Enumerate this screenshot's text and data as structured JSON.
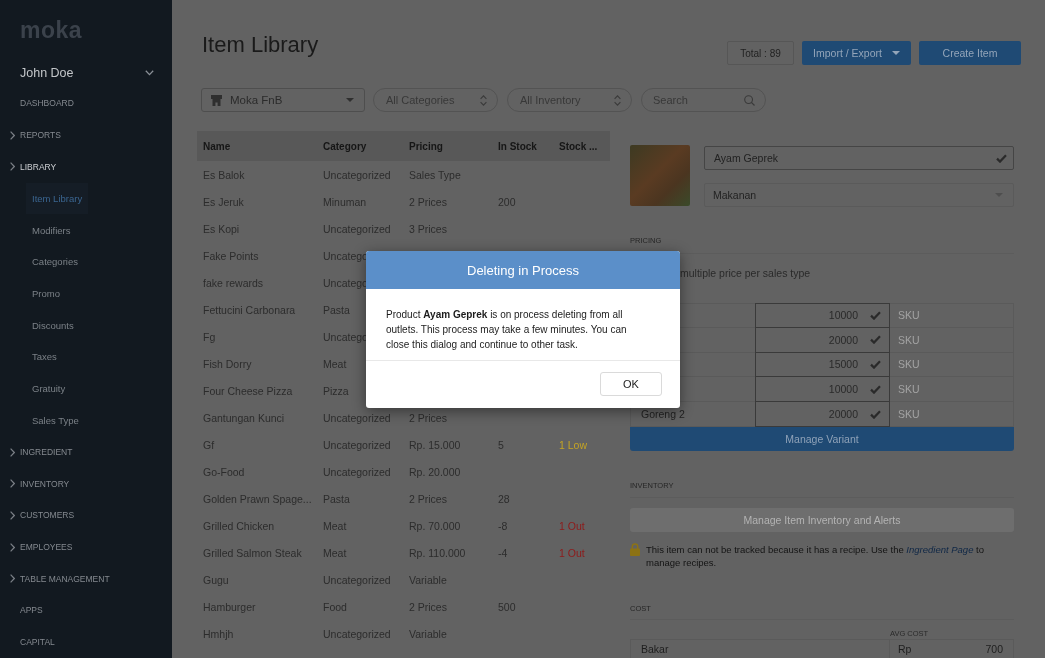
{
  "sidebar": {
    "logo": "moka",
    "user": "John Doe",
    "items": [
      {
        "label": "DASHBOARD",
        "kind": "link",
        "selected": false
      },
      {
        "label": "REPORTS",
        "kind": "group",
        "expanded": false,
        "selected": false
      },
      {
        "label": "LIBRARY",
        "kind": "group",
        "expanded": true,
        "selected": false,
        "children": [
          {
            "label": "Item Library",
            "selected": true
          },
          {
            "label": "Modifiers",
            "selected": false
          },
          {
            "label": "Categories",
            "selected": false
          },
          {
            "label": "Promo",
            "selected": false
          },
          {
            "label": "Discounts",
            "selected": false
          },
          {
            "label": "Taxes",
            "selected": false
          },
          {
            "label": "Gratuity",
            "selected": false
          },
          {
            "label": "Sales Type",
            "selected": false
          }
        ]
      },
      {
        "label": "INGREDIENT",
        "kind": "group",
        "expanded": false,
        "selected": false
      },
      {
        "label": "INVENTORY",
        "kind": "group",
        "expanded": false,
        "selected": false
      },
      {
        "label": "CUSTOMERS",
        "kind": "group",
        "expanded": false,
        "selected": false
      },
      {
        "label": "EMPLOYEES",
        "kind": "group",
        "expanded": false,
        "selected": false
      },
      {
        "label": "TABLE MANAGEMENT",
        "kind": "group",
        "expanded": false,
        "selected": false
      },
      {
        "label": "APPS",
        "kind": "link",
        "selected": false
      },
      {
        "label": "CAPITAL",
        "kind": "link",
        "selected": false
      }
    ]
  },
  "header": {
    "title": "Item Library",
    "total": "Total : 89",
    "buttons": [
      {
        "label": "Import / Export",
        "kind": "dropdown"
      },
      {
        "label": "Create Item",
        "kind": "primary"
      }
    ]
  },
  "filters": [
    {
      "kind": "outlet",
      "value": "Moka FnB"
    },
    {
      "kind": "select",
      "value": "All Categories"
    },
    {
      "kind": "select",
      "value": "All Inventory"
    },
    {
      "kind": "search",
      "placeholder": "Search"
    }
  ],
  "table": {
    "columns": [
      "Name",
      "Category",
      "Pricing",
      "In Stock",
      "Stock ..."
    ],
    "rows": [
      {
        "name": "Es Balok",
        "category": "Uncategorized",
        "pricing": "Sales Type"
      },
      {
        "name": "Es Jeruk",
        "category": "Minuman",
        "pricing": "2 Prices",
        "in_stock": "200"
      },
      {
        "name": "Es Kopi",
        "category": "Uncategorized",
        "pricing": "3 Prices"
      },
      {
        "name": "Fake Points",
        "category": "Uncatego"
      },
      {
        "name": "fake rewards",
        "category": "Uncatego"
      },
      {
        "name": "Fettucini Carbonara",
        "category": "Pasta"
      },
      {
        "name": "Fg",
        "category": "Uncatego"
      },
      {
        "name": "Fish Dorry",
        "category": "Meat"
      },
      {
        "name": "Four Cheese Pizza",
        "category": "Pizza"
      },
      {
        "name": "Gantungan Kunci",
        "category": "Uncategorized",
        "pricing": "2 Prices"
      },
      {
        "name": "Gf",
        "category": "Uncategorized",
        "pricing": "Rp. 15.000",
        "in_stock": "5",
        "stock_alert": {
          "text": "1 Low",
          "kind": "low"
        }
      },
      {
        "name": "Go-Food",
        "category": "Uncategorized",
        "pricing": "Rp. 20.000"
      },
      {
        "name": "Golden Prawn Spage...",
        "category": "Pasta",
        "pricing": "2 Prices",
        "in_stock": "28"
      },
      {
        "name": "Grilled Chicken",
        "category": "Meat",
        "pricing": "Rp. 70.000",
        "in_stock": "-8",
        "stock_alert": {
          "text": "1 Out",
          "kind": "out"
        }
      },
      {
        "name": "Grilled Salmon Steak",
        "category": "Meat",
        "pricing": "Rp. 110.000",
        "in_stock": "-4",
        "stock_alert": {
          "text": "1 Out",
          "kind": "out"
        }
      },
      {
        "name": "Gugu",
        "category": "Uncategorized",
        "pricing": "Variable"
      },
      {
        "name": "Hamburger",
        "category": "Food",
        "pricing": "2 Prices",
        "in_stock": "500"
      },
      {
        "name": "Hmhjh",
        "category": "Uncategorized",
        "pricing": "Variable"
      }
    ]
  },
  "item_detail": {
    "name": {
      "value": "Ayam Geprek",
      "valid": true
    },
    "category": "Makanan",
    "pricing": {
      "heading": "PRICING",
      "option": "multiple price per sales type",
      "variants": [
        {
          "price": "10000",
          "valid": true,
          "sku_placeholder": "SKU"
        },
        {
          "price": "20000",
          "valid": true,
          "sku_placeholder": "SKU"
        },
        {
          "price": "15000",
          "valid": true,
          "sku_placeholder": "SKU"
        },
        {
          "price": "10000",
          "valid": true,
          "sku_placeholder": "SKU"
        },
        {
          "name": "Goreng 2",
          "price": "20000",
          "valid": true,
          "sku_placeholder": "SKU"
        }
      ],
      "button": "Manage Variant"
    },
    "inventory": {
      "heading": "INVENTORY",
      "button": {
        "label": "Manage Item Inventory and Alerts",
        "disabled": true
      },
      "note": {
        "before": "This item can not be tracked because it has a recipe. Use the",
        "link": "Ingredient Page",
        "after": "to manage recipes."
      }
    },
    "cost": {
      "heading": "COST",
      "column": "AVG COST",
      "rows": [
        {
          "name": "Bakar",
          "currency": "Rp",
          "value": "700"
        }
      ]
    }
  },
  "modal": {
    "title": "Deleting in Process",
    "message": "Product **Ayam Geprek** is on process deleting from all outlets. This process may take a few minutes. You can close this dialog and continue to other task.",
    "button": "OK"
  }
}
